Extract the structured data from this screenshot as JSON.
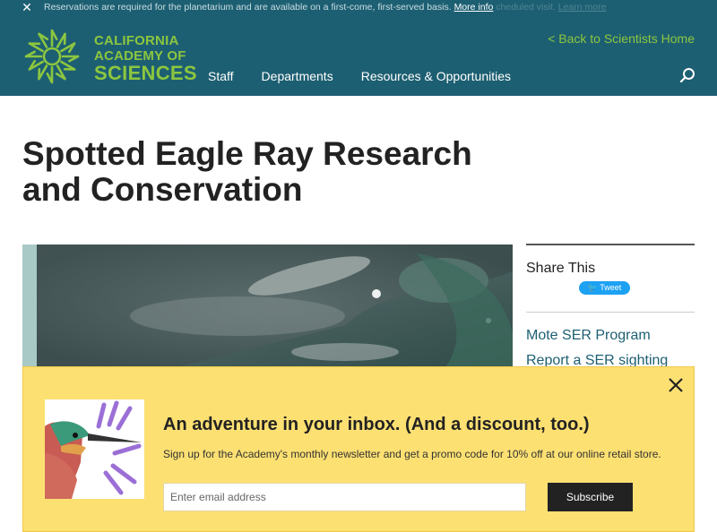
{
  "alert": {
    "message": "Reservations are required for the planetarium and are available on a first-come, first-served basis.",
    "more_info": "More info",
    "ghost_text": "cheduled visit.",
    "ghost_link": "Learn more"
  },
  "header": {
    "logo_line1": "CALIFORNIA",
    "logo_line2": "ACADEMY OF",
    "logo_line3": "SCIENCES",
    "back_link": "< Back to Scientists Home",
    "nav": [
      "Staff",
      "Departments",
      "Resources & Opportunities"
    ]
  },
  "page": {
    "title": "Spotted Eagle Ray Research and Conservation"
  },
  "sidebar": {
    "share_title": "Share This",
    "tweet_label": "Tweet",
    "links": [
      "Mote SER Program",
      "Report a SER sighting"
    ]
  },
  "newsletter": {
    "title": "An adventure in your inbox. (And a discount, too.)",
    "description": "Sign up for the Academy's monthly newsletter and get a promo code for 10% off at our online retail store.",
    "email_placeholder": "Enter email address",
    "submit_label": "Subscribe"
  },
  "colors": {
    "header_bg": "#1d5f72",
    "brand_green": "#8cc63f",
    "newsletter_bg": "#fde072",
    "link_teal": "#1d5f72"
  },
  "icons": [
    "close-icon",
    "search-icon",
    "academy-logo-icon",
    "twitter-bird-icon"
  ]
}
